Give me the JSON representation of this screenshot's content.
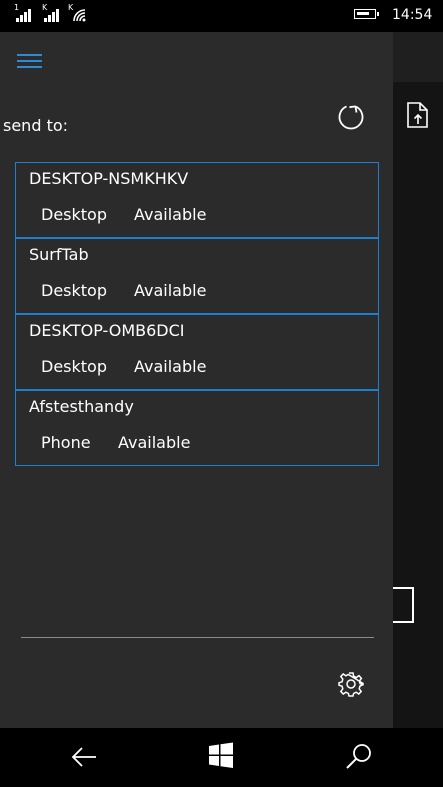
{
  "status_bar": {
    "sim1_label": "1",
    "sim2_label": "K",
    "wifi_label": "K",
    "time": "14:54"
  },
  "panel": {
    "send_label": "send to:"
  },
  "devices": [
    {
      "name": "DESKTOP-NSMKHKV",
      "type": "Desktop",
      "status": "Available"
    },
    {
      "name": "SurfTab",
      "type": "Desktop",
      "status": "Available"
    },
    {
      "name": "DESKTOP-OMB6DCI",
      "type": "Desktop",
      "status": "Available"
    },
    {
      "name": "Afstesthandy",
      "type": "Phone",
      "status": "Available"
    }
  ],
  "colors": {
    "accent": "#2d8ad3",
    "panel_bg": "#2b2b2b",
    "border": "#1e7fd1"
  },
  "icons": {
    "menu": "hamburger-icon",
    "refresh": "refresh-icon",
    "send_file": "send-file-icon",
    "settings": "gear-icon",
    "back": "back-arrow-icon",
    "start": "windows-logo-icon",
    "search": "search-icon"
  }
}
